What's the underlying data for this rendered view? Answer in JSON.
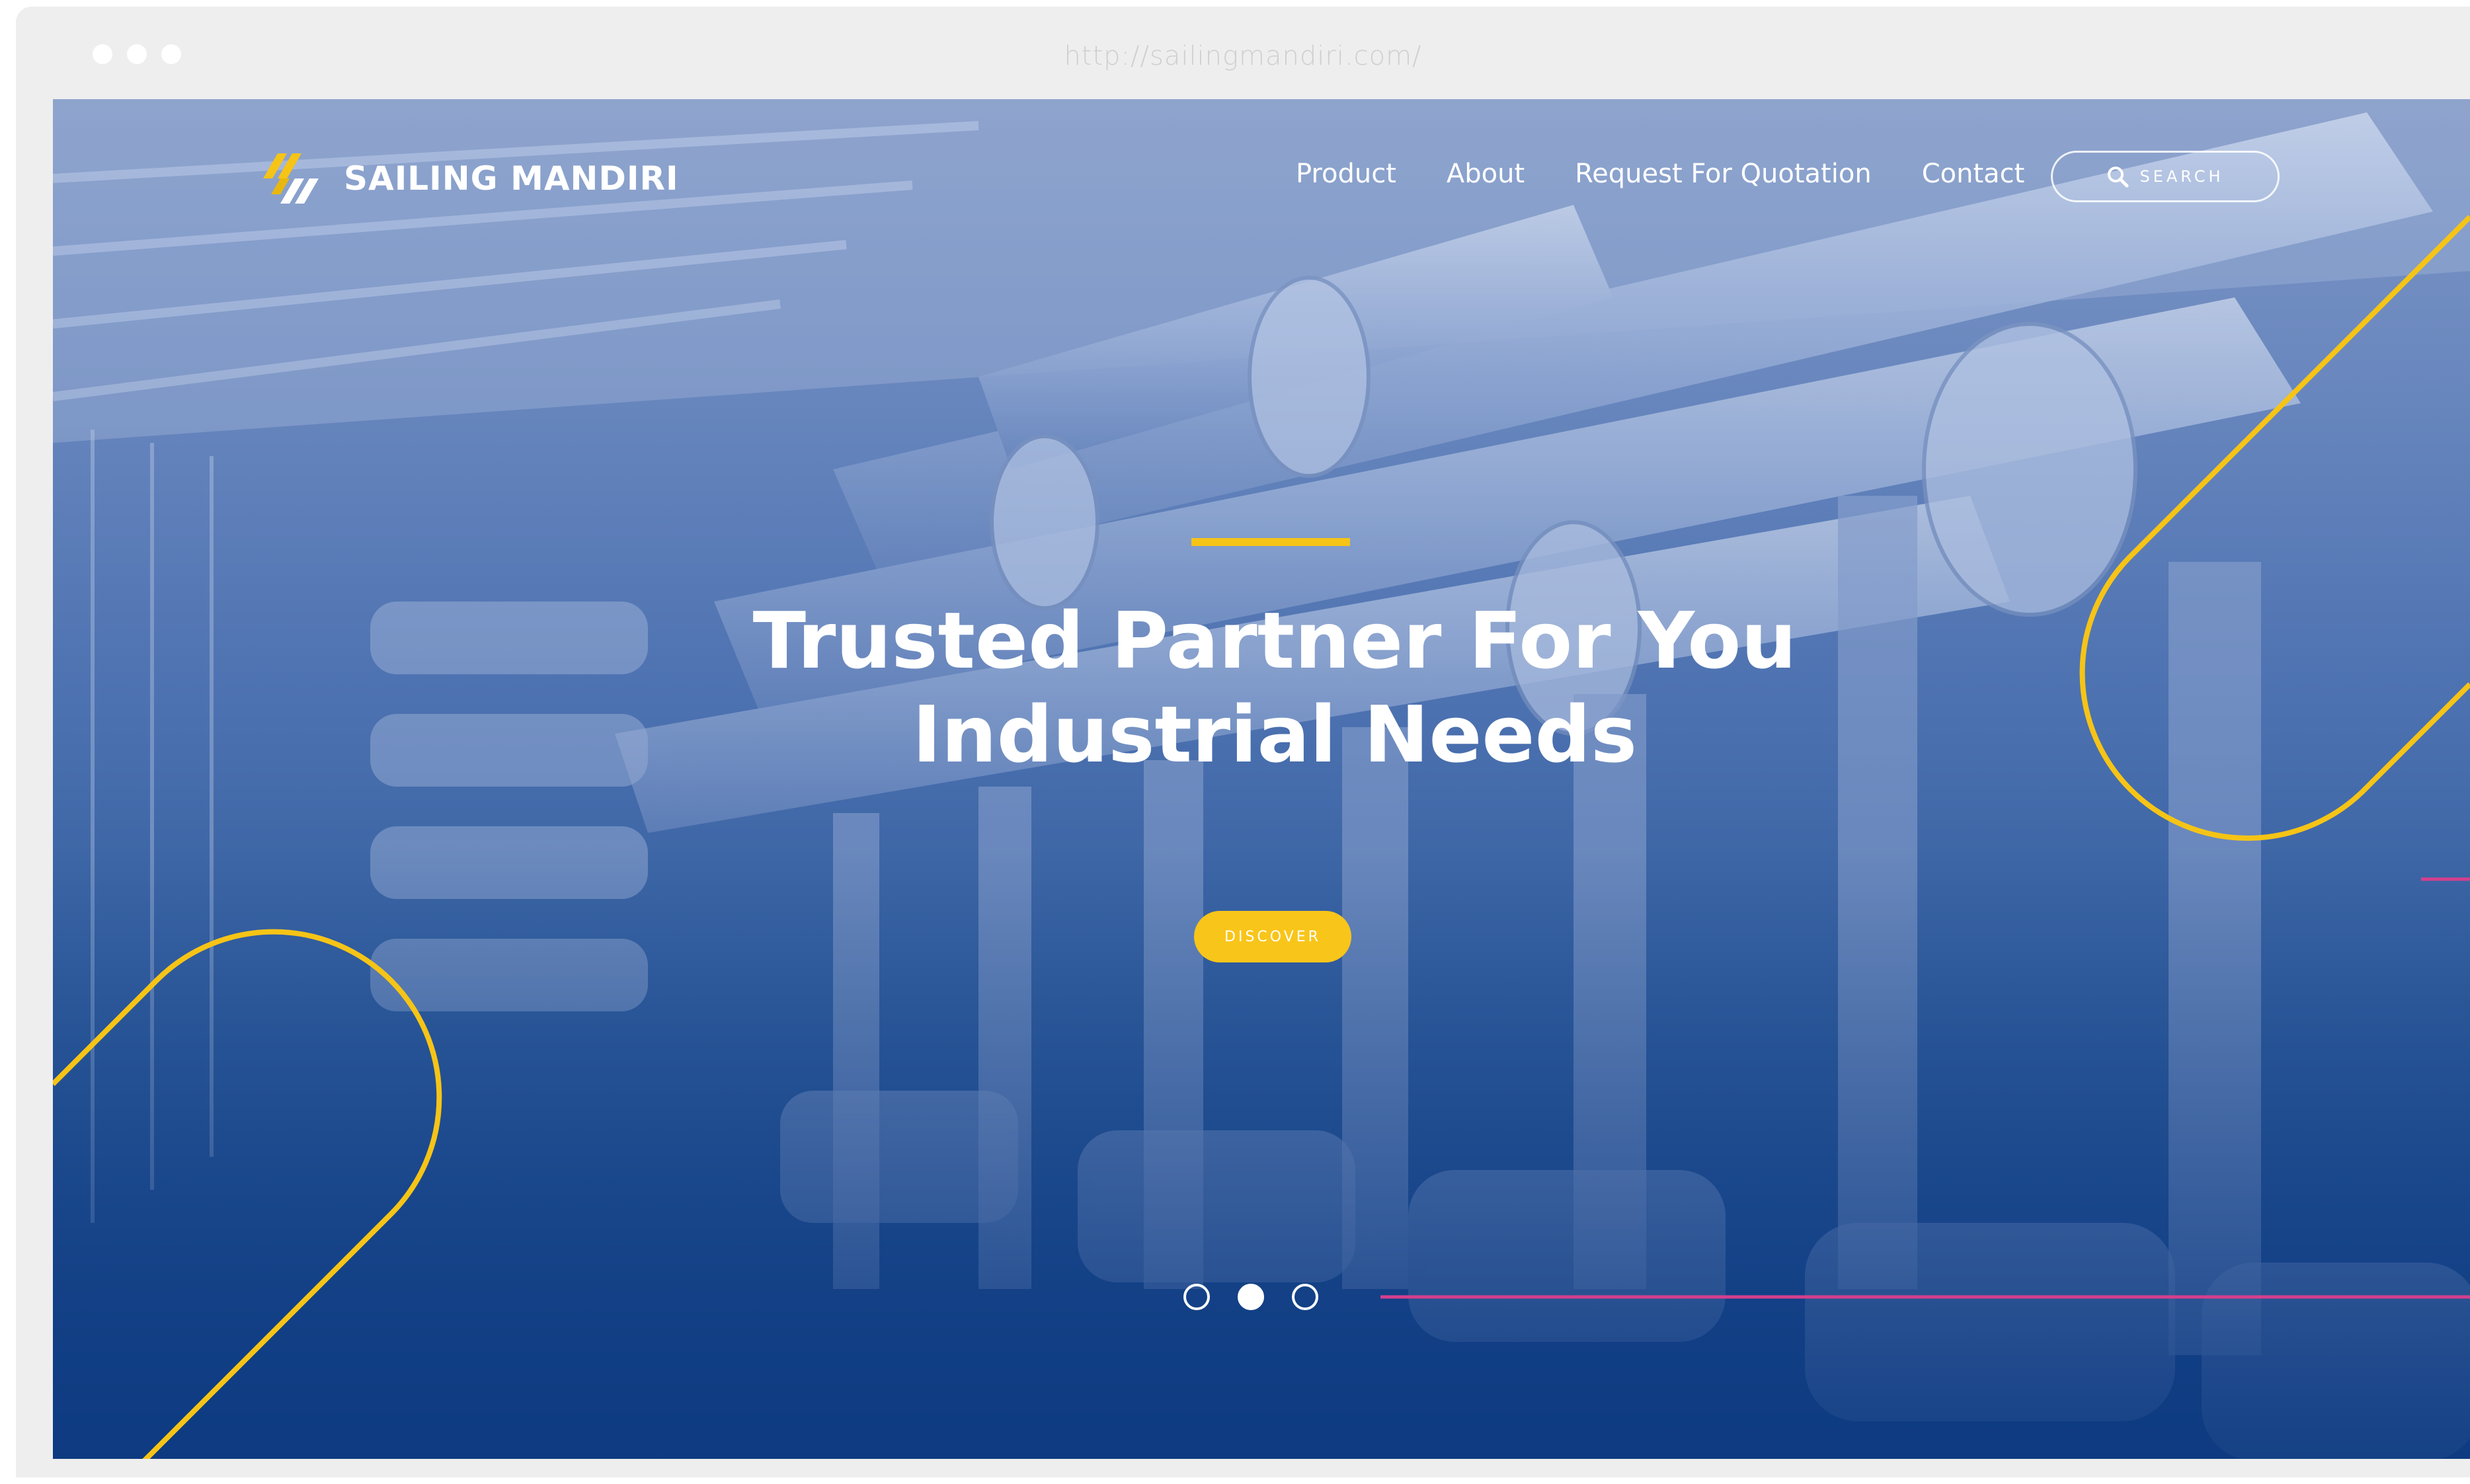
{
  "browser": {
    "url": "http://sailingmandiri.com/"
  },
  "header": {
    "brand": "SAILING MANDIRI",
    "nav": [
      {
        "label": "Product"
      },
      {
        "label": "About"
      },
      {
        "label": "Request For Quotation"
      },
      {
        "label": "Contact"
      }
    ],
    "search": {
      "label": "SEARCH",
      "icon": "search-icon"
    }
  },
  "hero": {
    "title_line1": "Trusted Partner For You",
    "title_line2": "Industrial Needs",
    "cta_label": "DISCOVER"
  },
  "carousel": {
    "slide_count": 3,
    "active_index": 1
  },
  "colors": {
    "accent_yellow": "#f6c416",
    "accent_magenta": "#d43f8d",
    "hero_blue_dark": "#123f86",
    "hero_blue_light": "#7f97c4"
  }
}
